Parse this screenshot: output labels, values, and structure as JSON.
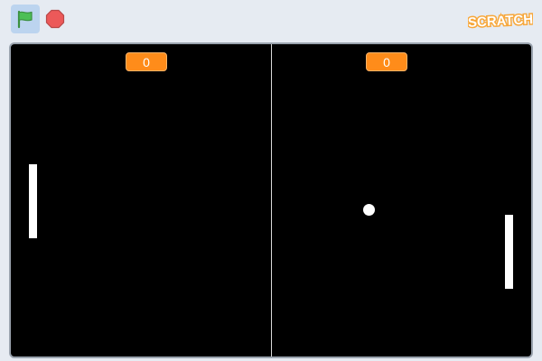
{
  "toolbar": {
    "green_flag_icon": "green-flag-icon",
    "stop_icon": "stop-sign-icon",
    "logo_text": "SCRATCH"
  },
  "game": {
    "score_left": "0",
    "score_right": "0"
  },
  "colors": {
    "stage_background": "#000000",
    "score_badge": "#ff8c1a",
    "paddle": "#ffffff",
    "ball": "#ffffff",
    "flag_green": "#4cbf56",
    "stop_red": "#ec5959",
    "logo_orange": "#f7a73b"
  }
}
